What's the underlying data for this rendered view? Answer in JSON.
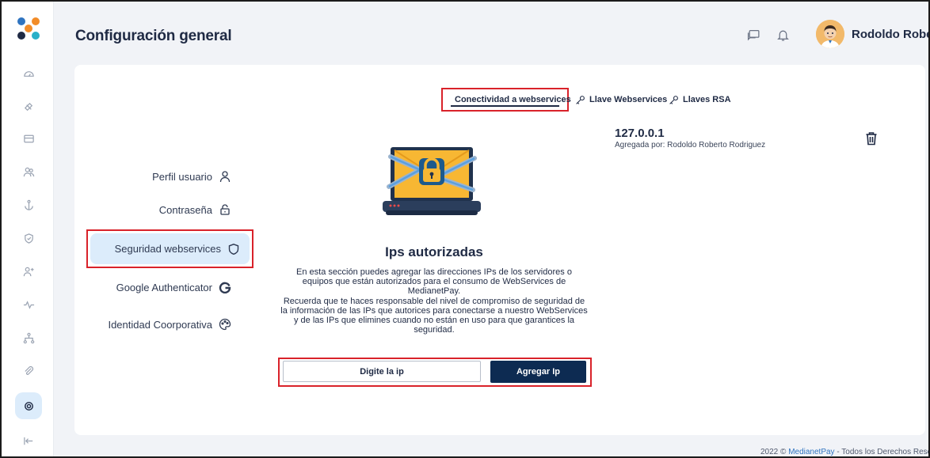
{
  "header": {
    "title": "Configuración general",
    "user_name": "Rodoldo Roberto"
  },
  "sidebar": {
    "logo_colors": [
      "#f28c28",
      "#2f74c0",
      "#1f2a44",
      "#2ab0c8"
    ],
    "items": [
      {
        "icon": "dashboard-icon"
      },
      {
        "icon": "link-icon"
      },
      {
        "icon": "credit-card-icon"
      },
      {
        "icon": "users-icon"
      },
      {
        "icon": "anchor-icon"
      },
      {
        "icon": "shield-icon"
      },
      {
        "icon": "add-user-icon"
      },
      {
        "icon": "activity-icon"
      },
      {
        "icon": "network-icon"
      },
      {
        "icon": "paperclip-icon"
      },
      {
        "icon": "settings-icon",
        "active": true
      },
      {
        "icon": "collapse-icon"
      }
    ]
  },
  "tabs": [
    {
      "label": "Conectividad a webservices",
      "active": true
    },
    {
      "label": "Llave Webservices"
    },
    {
      "label": "Llaves RSA"
    }
  ],
  "menu": [
    {
      "label": "Perfil usuario",
      "icon": "user-icon"
    },
    {
      "label": "Contraseña",
      "icon": "lock-icon"
    },
    {
      "label": "Seguridad webservices",
      "icon": "shield-icon",
      "active": true
    },
    {
      "label": "Google Authenticator",
      "icon": "google-icon"
    },
    {
      "label": "Identidad Coorporativa",
      "icon": "palette-icon"
    }
  ],
  "section": {
    "title": "Ips autorizadas",
    "description_lines": [
      "En esta sección puedes agregar las direcciones IPs de los servidores o",
      "equipos que están autorizados para el consumo de WebServices de",
      "MedianetPay.",
      "Recuerda que te haces responsable del nivel de compromiso de seguridad de",
      "la información de las IPs que autorices para conectarse a nuestro WebServices",
      "y de las IPs que elimines cuando no están en uso para que garantices la",
      "seguridad."
    ]
  },
  "form": {
    "ip_placeholder": "Digite la ip",
    "ip_value": "",
    "add_label": "Agregar Ip"
  },
  "ip_list": [
    {
      "ip": "127.0.0.1",
      "added_by": "Agregada por: Rodoldo Roberto Rodriguez"
    }
  ],
  "footer": {
    "year": "2022 ©",
    "brand": "MedianetPay",
    "rest": "- Todos los Derechos Reservados"
  },
  "colors": {
    "accent": "#0d2b52",
    "highlight": "#dcecfb",
    "annotation": "#d9222a",
    "background": "#f1f3f7"
  }
}
